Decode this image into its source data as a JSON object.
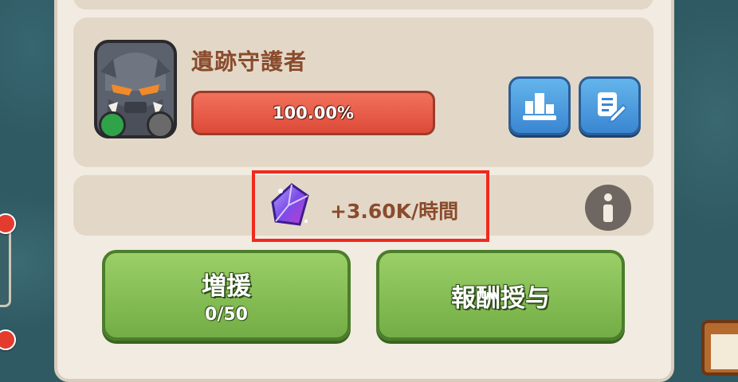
{
  "boss": {
    "name": "遺跡守護者",
    "hp_percent_label": "100.00%",
    "hp_fraction": 1.0
  },
  "reward_rate": {
    "text": "+3.60K/時間",
    "icon": "purple-crystal-icon"
  },
  "buttons": {
    "ranking_icon": "podium-icon",
    "log_icon": "edit-document-icon",
    "info_icon": "info-icon",
    "support": {
      "label": "増援",
      "count": "0/50"
    },
    "reward": {
      "label": "報酬授与"
    }
  },
  "colors": {
    "accent_text": "#8a4b2d",
    "hp_red": "#dd4a38",
    "blue_button": "#3a86d2",
    "green_button": "#73ad45",
    "highlight_border": "#f02a1d"
  }
}
